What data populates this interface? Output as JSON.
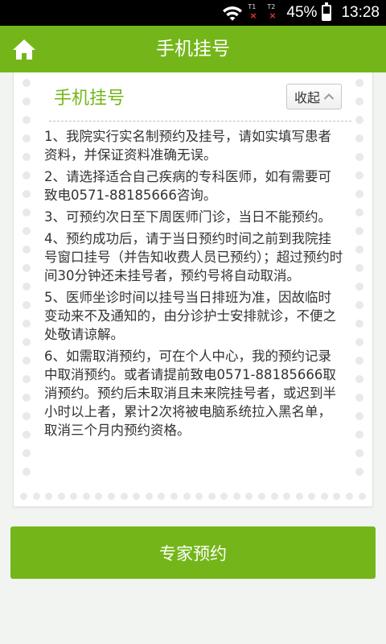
{
  "status_bar": {
    "sim1_label": "T1",
    "sim2_label": "T2",
    "no_signal_mark": "×",
    "battery_percent_text": "45%",
    "battery_level": 0.45,
    "time": "13:28",
    "icons": [
      "wifi-icon",
      "sim-no-signal-icon",
      "battery-icon"
    ]
  },
  "header": {
    "title": "手机挂号",
    "home_icon": "home-icon"
  },
  "card": {
    "section_title": "手机挂号",
    "collapse_label": "收起",
    "collapse_icon": "chevron-up-icon",
    "notices": [
      "1、我院实行实名制预约及挂号，请如实填写患者资料，并保证资料准确无误。",
      "2、请选择适合自己疾病的专科医师，如有需要可致电0571-88185666咨询。",
      "3、可预约次日至下周医师门诊，当日不能预约。",
      "4、预约成功后，请于当日预约时间之前到我院挂号窗口挂号（并告知收费人员已预约）；超过预约时间30分钟还未挂号者，预约号将自动取消。",
      "5、医师坐诊时间以挂号当日排班为准，因故临时变动来不及通知的，由分诊护士安排就诊，不便之处敬请谅解。",
      "6、如需取消预约，可在个人中心，我的预约记录中取消预约。或者请提前致电0571-88185666取消预约。预约后未取消且未来院挂号者，或迟到半小时以上者，累计2次将被电脑系统拉入黑名单，取消三个月内预约资格。"
    ]
  },
  "action": {
    "button_label": "专家预约"
  },
  "colors": {
    "brand_green": "#74b61a",
    "background": "#f1f4f1"
  }
}
